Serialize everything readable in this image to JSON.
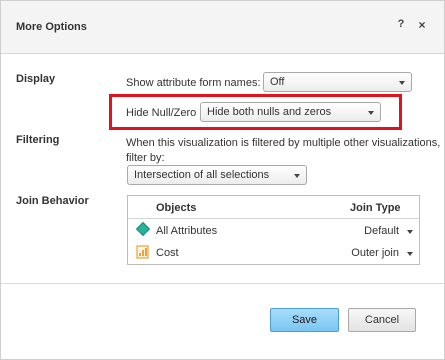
{
  "dialog": {
    "title": "More Options",
    "help_label": "?",
    "close_label": "×"
  },
  "display": {
    "section_label": "Display",
    "attr_form_label": "Show attribute form names:",
    "attr_form_value": "Off",
    "hide_null_label": "Hide Null/Zero",
    "hide_null_value": "Hide both nulls and zeros"
  },
  "filtering": {
    "section_label": "Filtering",
    "description_line1": "When this visualization is filtered by multiple other visualizations,",
    "description_line2": "filter by:",
    "filter_value": "Intersection of all selections"
  },
  "join": {
    "section_label": "Join Behavior",
    "columns": {
      "objects": "Objects",
      "join_type": "Join Type"
    },
    "rows": [
      {
        "name": "All Attributes",
        "icon": "attribute-diamond-icon",
        "join_type": "Default"
      },
      {
        "name": "Cost",
        "icon": "metric-icon",
        "join_type": "Outer join"
      }
    ]
  },
  "buttons": {
    "save": "Save",
    "cancel": "Cancel"
  },
  "colors": {
    "highlight": "#e0141e",
    "save_button": "#79c6f2",
    "attribute_icon": "#27b39b",
    "metric_icon": "#e8a33c"
  }
}
